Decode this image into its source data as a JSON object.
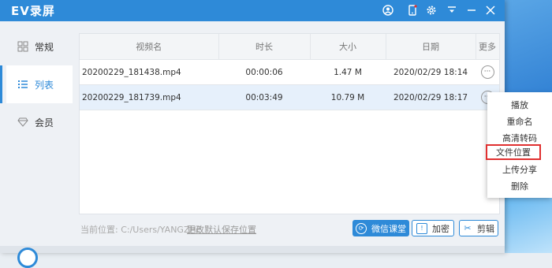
{
  "app": {
    "title": "EV录屏"
  },
  "sidebar": {
    "items": [
      {
        "label": "常规",
        "icon": "grid-icon"
      },
      {
        "label": "列表",
        "icon": "list-icon"
      },
      {
        "label": "会员",
        "icon": "diamond-icon"
      }
    ]
  },
  "table": {
    "headers": [
      "视频名",
      "时长",
      "大小",
      "日期",
      "更多"
    ],
    "rows": [
      {
        "name": "20200229_181438.mp4",
        "duration": "00:00:06",
        "size": "1.47 M",
        "date": "2020/02/29 18:14",
        "more": "···"
      },
      {
        "name": "20200229_181739.mp4",
        "duration": "00:03:49",
        "size": "10.79 M",
        "date": "2020/02/29 18:17",
        "more": "···"
      }
    ]
  },
  "footer": {
    "save_path": "当前位置:  C:/Users/YANGZHE",
    "change_path": "更改默认保存位置",
    "btn_wechat": "微信课堂",
    "btn_encrypt": "加密",
    "btn_cut": "剪辑"
  },
  "context_menu": {
    "items": [
      "播放",
      "重命名",
      "高清转码",
      "文件位置",
      "上传分享",
      "删除"
    ]
  },
  "colors": {
    "accent": "#2e8ad8",
    "highlight_border": "#e03030"
  }
}
